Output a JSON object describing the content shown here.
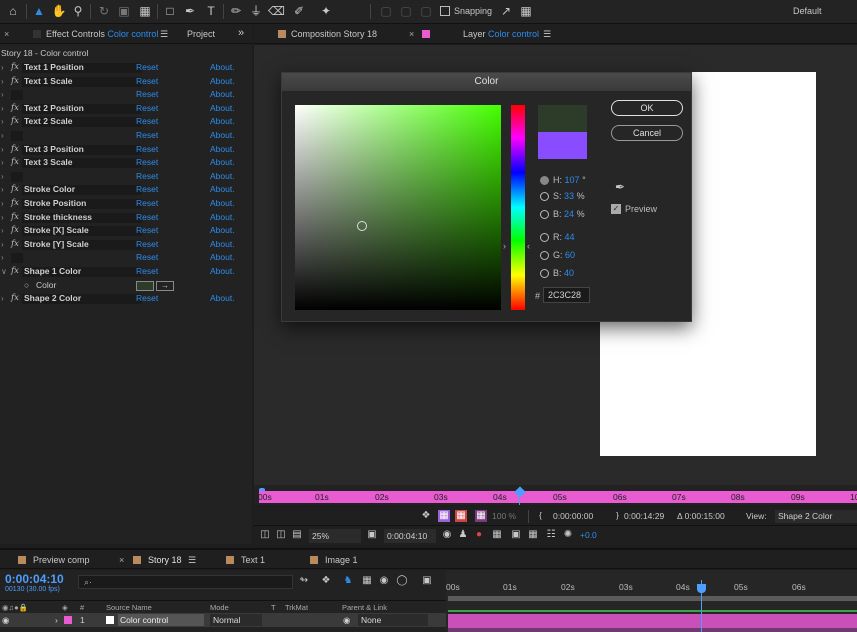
{
  "toolbar": {
    "snapping_label": "Snapping",
    "workspace_label": "Default"
  },
  "effect_controls": {
    "tab_label_prefix": "Effect Controls",
    "tab_label_layer": "Color control",
    "project_tab": "Project",
    "subtitle": "Story 18 - Color control",
    "reset_label": "Reset",
    "about_label": "About.",
    "color_prop_label": "Color",
    "rows": [
      {
        "name": "Text 1 Position",
        "type": "effect"
      },
      {
        "name": "Text 1 Scale",
        "type": "effect"
      },
      {
        "name": "",
        "type": "hidden"
      },
      {
        "name": "Text 2 Position",
        "type": "effect"
      },
      {
        "name": "Text 2 Scale",
        "type": "effect"
      },
      {
        "name": "",
        "type": "hidden"
      },
      {
        "name": "Text 3 Position",
        "type": "effect"
      },
      {
        "name": "Text 3 Scale",
        "type": "effect"
      },
      {
        "name": "",
        "type": "hidden"
      },
      {
        "name": "Stroke Color",
        "type": "effect"
      },
      {
        "name": "Stroke Position",
        "type": "effect"
      },
      {
        "name": "Stroke thickness",
        "type": "effect"
      },
      {
        "name": "Stroke [X] Scale",
        "type": "effect"
      },
      {
        "name": "Stroke [Y] Scale",
        "type": "effect"
      },
      {
        "name": "",
        "type": "hidden"
      },
      {
        "name": "Shape 1 Color",
        "type": "effect-open"
      },
      {
        "name": "Color",
        "type": "property"
      },
      {
        "name": "Shape 2 Color",
        "type": "effect"
      }
    ]
  },
  "composition": {
    "tab_comp": "Composition Story 18",
    "tab_layer_prefix": "Layer",
    "tab_layer_name": "Color control"
  },
  "color_dialog": {
    "title": "Color",
    "ok": "OK",
    "cancel": "Cancel",
    "preview_label": "Preview",
    "preview_checked": true,
    "new_color": "#2C3C28",
    "old_color": "#8A4CFF",
    "fields": [
      {
        "label": "H:",
        "value": "107",
        "unit": "°",
        "selected": true
      },
      {
        "label": "S:",
        "value": "33",
        "unit": "%",
        "selected": false
      },
      {
        "label": "B:",
        "value": "24",
        "unit": "%",
        "selected": false
      },
      {
        "label": "R:",
        "value": "44",
        "unit": "",
        "selected": false
      },
      {
        "label": "G:",
        "value": "60",
        "unit": "",
        "selected": false
      },
      {
        "label": "B:",
        "value": "40",
        "unit": "",
        "selected": false
      }
    ],
    "hex_prefix": "#",
    "hex_value": "2C3C28"
  },
  "time_ruler": {
    "labels": [
      "00s",
      "01s",
      "02s",
      "03s",
      "04s",
      "05s",
      "06s",
      "07s",
      "08s",
      "09s",
      "10"
    ]
  },
  "viewer_controls": {
    "resolution": "100 %",
    "current_time": "0:00:00:00",
    "end_time": "0:00:14:29",
    "duration_label": "Δ 0:00:15:00",
    "view_label": "View:",
    "view_value": "Shape 2 Color",
    "zoom": "25%",
    "time": "0:00:04:10",
    "exposure": "+0.0"
  },
  "timeline": {
    "tabs": [
      "Preview comp",
      "Story 18",
      "Text 1",
      "Image 1"
    ],
    "timecode": "0:00:04:10",
    "fps": "00130 (30.00 fps)",
    "search_placeholder": "⌕·",
    "col_number": "#",
    "col_source": "Source Name",
    "col_mode": "Mode",
    "col_t": "T",
    "col_trkmat": "TrkMat",
    "col_parent": "Parent & Link",
    "ruler_labels": [
      "00s",
      "01s",
      "02s",
      "03s",
      "04s",
      "05s",
      "06s"
    ],
    "layer": {
      "number": "1",
      "name": "Color control",
      "mode": "Normal",
      "parent": "None"
    }
  }
}
